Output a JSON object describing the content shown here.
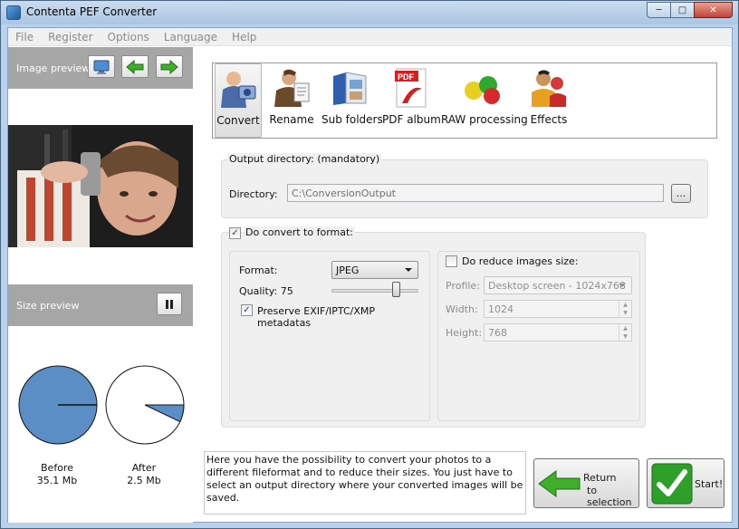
{
  "window": {
    "title": "Contenta PEF Converter",
    "buttons": [
      "minimize",
      "maximize",
      "close"
    ]
  },
  "menu": [
    "File",
    "Register",
    "Options",
    "Language",
    "Help"
  ],
  "left_panel": {
    "image_preview_label": "Image preview",
    "size_preview_label": "Size preview",
    "before": {
      "label": "Before",
      "value": "35.1 Mb"
    },
    "after": {
      "label": "After",
      "value": "2.5 Mb",
      "fraction": 0.071
    }
  },
  "toolbar": {
    "items": [
      {
        "label": "Convert",
        "icon": "convert-icon",
        "active": true
      },
      {
        "label": "Rename",
        "icon": "rename-icon",
        "active": false
      },
      {
        "label": "Sub folders",
        "icon": "sub-folders-icon",
        "active": false
      },
      {
        "label": "PDF album",
        "icon": "pdf-album-icon",
        "active": false
      },
      {
        "label": "RAW processing",
        "icon": "raw-processing-icon",
        "active": false
      },
      {
        "label": "Effects",
        "icon": "effects-icon",
        "active": false
      }
    ]
  },
  "output": {
    "group_title": "Output directory: (mandatory)",
    "directory_label": "Directory:",
    "directory_value": "C:\\ConversionOutput",
    "browse_label": "..."
  },
  "convert": {
    "checkbox_label": "Do convert to format:",
    "checked": true,
    "format_label": "Format:",
    "format_value": "JPEG",
    "quality_label": "Quality: 75",
    "quality_value": 75,
    "exif_label": "Preserve EXIF/IPTC/XMP metadatas",
    "exif_checked": true
  },
  "reduce": {
    "checkbox_label": "Do reduce images size:",
    "checked": false,
    "profile_label": "Profile:",
    "profile_value": "Desktop screen - 1024x768",
    "width_label": "Width:",
    "width_value": "1024",
    "height_label": "Height:",
    "height_value": "768"
  },
  "help_text": "Here you have the possibility to convert your photos to a different fileformat and to reduce their sizes. You just have to select an output directory where your converted images will be saved.",
  "actions": {
    "return_line1": "Return",
    "return_line2": "to selection",
    "start_label": "Start!"
  },
  "colors": {
    "pie_fill": "#5b8ec4",
    "panel_header": "#a6a6a6",
    "arrow_green": "#3fae2a"
  }
}
